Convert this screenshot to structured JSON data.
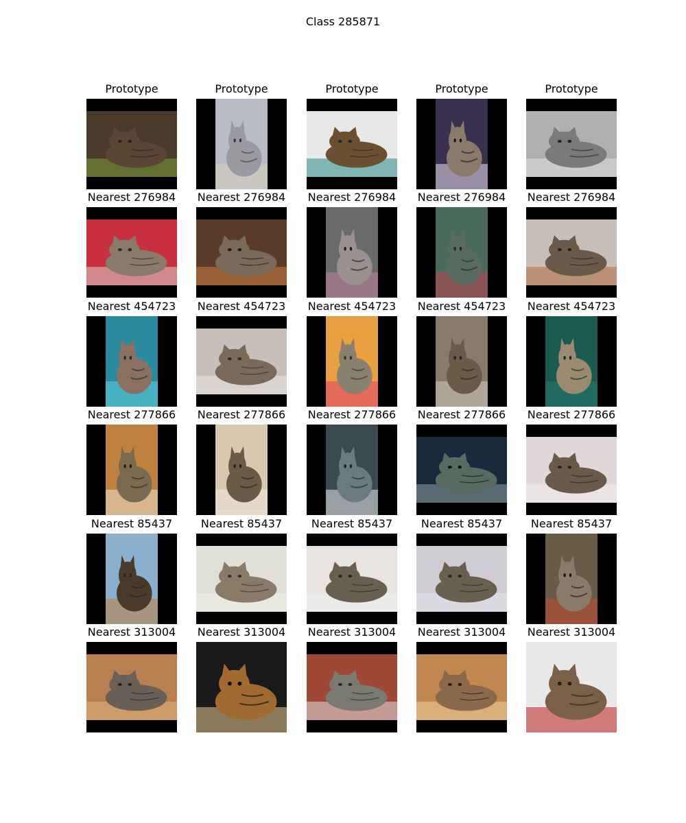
{
  "figure": {
    "title": "Class 285871"
  },
  "rows": [
    {
      "label": "Prototype",
      "cells": [
        {
          "aspect": "landscape",
          "bg": "#4a3a2a",
          "fur": "#5a4634",
          "accent": "#7a9a3a",
          "dark": "#2a2018"
        },
        {
          "aspect": "portrait",
          "bg": "#b8bcc4",
          "fur": "#9a9aa0",
          "accent": "#d8d0c0",
          "dark": "#3a3a40"
        },
        {
          "aspect": "landscape",
          "bg": "#e8e8e8",
          "fur": "#6a5030",
          "accent": "#2a8a8a",
          "dark": "#1a2a2a"
        },
        {
          "aspect": "portrait",
          "bg": "#3a3050",
          "fur": "#8a7a6a",
          "accent": "#e8e0f0",
          "dark": "#1a1420"
        },
        {
          "aspect": "landscape",
          "bg": "#b0b0b0",
          "fur": "#7a7a7a",
          "accent": "#e0e0e0",
          "dark": "#202020"
        }
      ]
    },
    {
      "label": "Nearest 276984",
      "cells": [
        {
          "aspect": "landscape",
          "bg": "#c83040",
          "fur": "#8a7a6a",
          "accent": "#d8d0c8",
          "dark": "#2a2a2a"
        },
        {
          "aspect": "landscape",
          "bg": "#5a3a28",
          "fur": "#7a6a5a",
          "accent": "#d08040",
          "dark": "#2a1a10"
        },
        {
          "aspect": "portrait",
          "bg": "#6a6a6a",
          "fur": "#9a9090",
          "accent": "#c080a0",
          "dark": "#1a1a1a"
        },
        {
          "aspect": "portrait",
          "bg": "#4a6a5a",
          "fur": "#5a6a60",
          "accent": "#c04050",
          "dark": "#1a2a20"
        },
        {
          "aspect": "landscape",
          "bg": "#c8c0b8",
          "fur": "#6a5a4a",
          "accent": "#b06a40",
          "dark": "#2a2018"
        }
      ]
    },
    {
      "label": "Nearest 454723",
      "cells": [
        {
          "aspect": "portrait",
          "bg": "#2a8aa0",
          "fur": "#8a7060",
          "accent": "#60d0e0",
          "dark": "#1a2a30"
        },
        {
          "aspect": "landscape",
          "bg": "#c8c0b8",
          "fur": "#7a6a5a",
          "accent": "#e8e4e0",
          "dark": "#3a2a20"
        },
        {
          "aspect": "portrait",
          "bg": "#e8a040",
          "fur": "#8a8070",
          "accent": "#e04070",
          "dark": "#3a3028"
        },
        {
          "aspect": "portrait",
          "bg": "#8a7a6a",
          "fur": "#6a5a48",
          "accent": "#d0c8c0",
          "dark": "#2a2018"
        },
        {
          "aspect": "portrait",
          "bg": "#1a5a50",
          "fur": "#9a8a70",
          "accent": "#2a7a70",
          "dark": "#0a2a24"
        }
      ]
    },
    {
      "label": "Nearest 277866",
      "cells": [
        {
          "aspect": "portrait",
          "bg": "#c08040",
          "fur": "#7a6a50",
          "accent": "#e8e0d0",
          "dark": "#2a2010"
        },
        {
          "aspect": "portrait",
          "bg": "#d8c8b0",
          "fur": "#6a5a48",
          "accent": "#f0e8e0",
          "dark": "#2a2018"
        },
        {
          "aspect": "portrait",
          "bg": "#3a4a50",
          "fur": "#6a7a80",
          "accent": "#e8e8e8",
          "dark": "#1a2028"
        },
        {
          "aspect": "landscape",
          "bg": "#1a2a3a",
          "fur": "#5a6a60",
          "accent": "#8aa0a0",
          "dark": "#0a1018"
        },
        {
          "aspect": "landscape",
          "bg": "#e0d8d8",
          "fur": "#6a5a4a",
          "accent": "#f4eeee",
          "dark": "#2a2018"
        }
      ]
    },
    {
      "label": "Nearest 85437",
      "cells": [
        {
          "aspect": "portrait",
          "bg": "#8ab0d0",
          "fur": "#4a3a2a",
          "accent": "#c08040",
          "dark": "#2a2018"
        },
        {
          "aspect": "landscape",
          "bg": "#e0e0d8",
          "fur": "#8a7a68",
          "accent": "#f0f0e8",
          "dark": "#3a3028"
        },
        {
          "aspect": "landscape",
          "bg": "#e8e4e0",
          "fur": "#6a6050",
          "accent": "#f0f0f0",
          "dark": "#2a2820"
        },
        {
          "aspect": "landscape",
          "bg": "#d0ccd4",
          "fur": "#6a6050",
          "accent": "#e8e4ec",
          "dark": "#2a2820"
        },
        {
          "aspect": "portrait",
          "bg": "#6a5a48",
          "fur": "#8a7a6a",
          "accent": "#c04a30",
          "dark": "#1a1410"
        }
      ]
    },
    {
      "label": "Nearest 313004",
      "cells": [
        {
          "aspect": "landscape",
          "bg": "#b88050",
          "fur": "#6a6058",
          "accent": "#e0b080",
          "dark": "#2a2018"
        },
        {
          "aspect": "square",
          "bg": "#1a1a1a",
          "fur": "#a06a30",
          "accent": "#e8c890",
          "dark": "#0a0a0a"
        },
        {
          "aspect": "landscape",
          "bg": "#a04838",
          "fur": "#7a7a70",
          "accent": "#e0e0e0",
          "dark": "#2a2824"
        },
        {
          "aspect": "landscape",
          "bg": "#c08850",
          "fur": "#8a6a4a",
          "accent": "#f0d0a0",
          "dark": "#2a1a10"
        },
        {
          "aspect": "square",
          "bg": "#e8e8e8",
          "fur": "#7a6048",
          "accent": "#c02020",
          "dark": "#2a2018"
        }
      ]
    }
  ]
}
